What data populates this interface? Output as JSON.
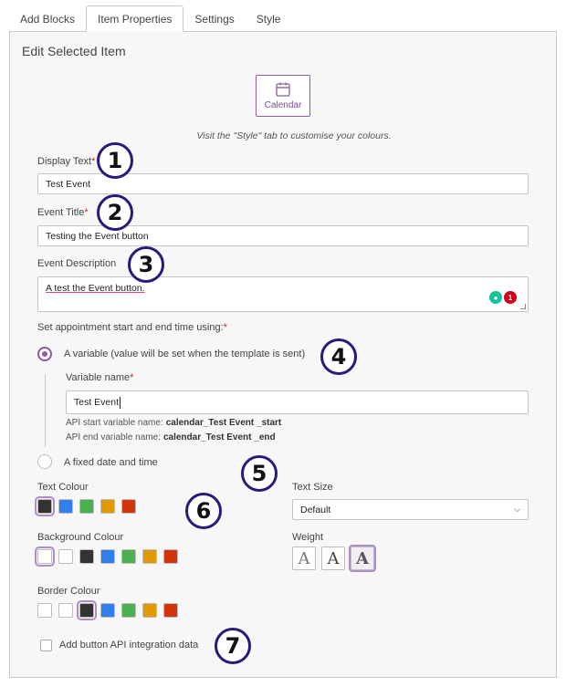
{
  "tabs": [
    {
      "label": "Add Blocks"
    },
    {
      "label": "Item Properties"
    },
    {
      "label": "Settings"
    },
    {
      "label": "Style"
    }
  ],
  "panel": {
    "title": "Edit Selected Item",
    "calendar_button_label": "Calendar",
    "hint": "Visit the \"Style\" tab to customise your colours."
  },
  "fields": {
    "display_text_label": "Display Text",
    "display_text_value": "Test Event",
    "event_title_label": "Event Title",
    "event_title_value": "Testing the Event button",
    "event_description_label": "Event Description",
    "event_description_value": "A test the Event button.",
    "grammar_count": "1",
    "required_mark": "*"
  },
  "appointment": {
    "label": "Set appointment start and end time using:",
    "option_variable": "A variable (value will be set when the template is sent)",
    "variable_name_label": "Variable name",
    "variable_name_value": "Test Event",
    "api_start_label": "API start variable name:",
    "api_start_value": "calendar_Test Event _start",
    "api_end_label": "API end variable name:",
    "api_end_value": "calendar_Test Event _end",
    "option_fixed": "A fixed date and time"
  },
  "style": {
    "text_colour_label": "Text Colour",
    "background_colour_label": "Background Colour",
    "border_colour_label": "Border Colour",
    "text_size_label": "Text Size",
    "text_size_value": "Default",
    "weight_label": "Weight",
    "weight_glyph": "A"
  },
  "api_checkbox_label": "Add button API integration data",
  "badges": [
    "1",
    "2",
    "3",
    "4",
    "5",
    "6",
    "7"
  ],
  "colors": {
    "accent": "#8c5aa6",
    "black": "#333333",
    "blue": "#2f80ed",
    "green": "#4caf50",
    "orange": "#e09a00",
    "red": "#d0350e",
    "white": "#ffffff"
  }
}
